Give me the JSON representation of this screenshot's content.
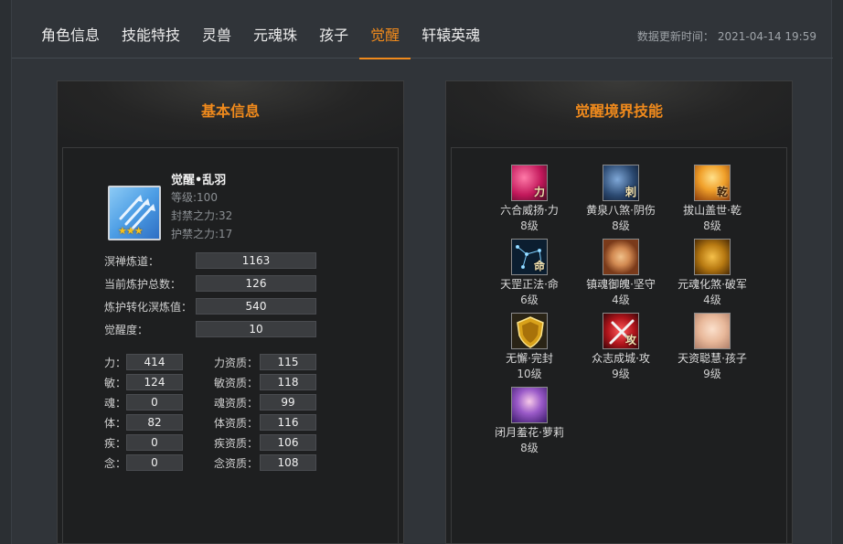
{
  "tabs": [
    {
      "label": "角色信息",
      "active": false
    },
    {
      "label": "技能特技",
      "active": false
    },
    {
      "label": "灵兽",
      "active": false
    },
    {
      "label": "元魂珠",
      "active": false
    },
    {
      "label": "孩子",
      "active": false
    },
    {
      "label": "觉醒",
      "active": true
    },
    {
      "label": "轩辕英魂",
      "active": false
    }
  ],
  "update": {
    "label": "数据更新时间：",
    "value": "2021-04-14 19:59"
  },
  "accent_color": "#f08a1c",
  "basic": {
    "title": "基本信息",
    "hero": {
      "name": "觉醒•乱羽",
      "level": "等级:100",
      "seal_power": "封禁之力:32",
      "guard_power": "护禁之力:17",
      "stars": "★★★",
      "icon": "triple-arrow-icon"
    },
    "stats": [
      {
        "label": "溟禅炼道：",
        "value": "1163"
      },
      {
        "label": "当前炼护总数：",
        "value": "126"
      },
      {
        "label": "炼护转化溟炼值：",
        "value": "540"
      },
      {
        "label": "觉醒度：",
        "value": "10"
      }
    ],
    "attrs": [
      {
        "label": "力：",
        "value": "414",
        "q_label": "力资质：",
        "q_value": "115"
      },
      {
        "label": "敏：",
        "value": "124",
        "q_label": "敏资质：",
        "q_value": "118"
      },
      {
        "label": "魂：",
        "value": "0",
        "q_label": "魂资质：",
        "q_value": "99"
      },
      {
        "label": "体：",
        "value": "82",
        "q_label": "体资质：",
        "q_value": "116"
      },
      {
        "label": "疾：",
        "value": "0",
        "q_label": "疾资质：",
        "q_value": "106"
      },
      {
        "label": "念：",
        "value": "0",
        "q_label": "念资质：",
        "q_value": "108"
      }
    ]
  },
  "skills": {
    "title": "觉醒境界技能",
    "items": [
      {
        "name": "六合威扬·力",
        "level": "8级",
        "glyph": "力",
        "icon": "power-icon",
        "color": "#c2185b"
      },
      {
        "name": "黄泉八煞·阴伤",
        "level": "8级",
        "glyph": "刺",
        "icon": "skull-stab-icon",
        "color": "#2c4a72"
      },
      {
        "name": "拔山盖世·乾",
        "level": "8级",
        "glyph": "乾",
        "icon": "qian-flame-icon",
        "color": "#d9791a"
      },
      {
        "name": "天罡正法·命",
        "level": "6级",
        "glyph": "命",
        "icon": "constellation-icon",
        "color": "#123a5a"
      },
      {
        "name": "镇魂御魄·坚守",
        "level": "4级",
        "glyph": "",
        "icon": "portrait-woman-icon",
        "color": "#b5693a"
      },
      {
        "name": "元魂化煞·破军",
        "level": "4级",
        "glyph": "",
        "icon": "demon-mask-icon",
        "color": "#a86b10"
      },
      {
        "name": "无懈·完封",
        "level": "10级",
        "glyph": "",
        "icon": "golden-shield-icon",
        "color": "#8c6a10"
      },
      {
        "name": "众志成城·攻",
        "level": "9级",
        "glyph": "攻",
        "icon": "crossed-swords-icon",
        "color": "#b0141b"
      },
      {
        "name": "天资聪慧·孩子",
        "level": "9级",
        "glyph": "",
        "icon": "baby-face-icon",
        "color": "#e8b89a"
      },
      {
        "name": "闭月羞花·萝莉",
        "level": "8级",
        "glyph": "",
        "icon": "loli-portrait-icon",
        "color": "#6a3a9a"
      }
    ]
  }
}
